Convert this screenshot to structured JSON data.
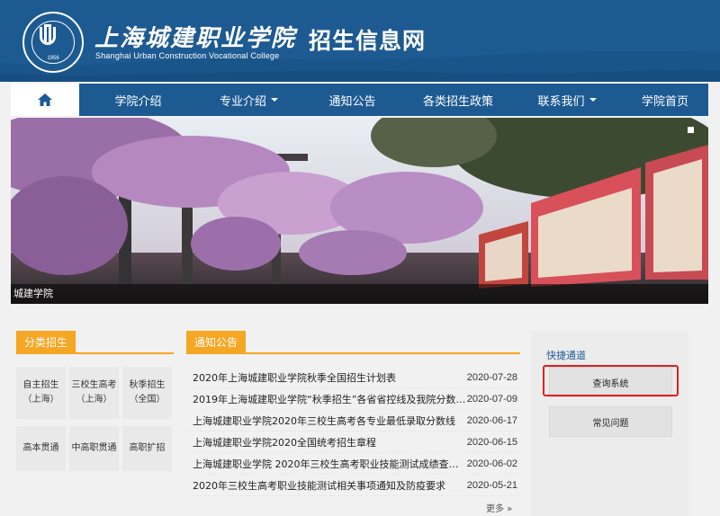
{
  "header": {
    "college_name_cn": "上海城建职业学院",
    "college_name_en": "Shanghai Urban Construction Vocational College",
    "site_title": "招生信息网",
    "logo_year": "1956",
    "logo_ring_text": "SHANGHAI URBAN CONSTRUCTION VOCATIONAL COLLEGE"
  },
  "nav": {
    "home_icon": "home-icon",
    "items": [
      {
        "label": "学院介绍",
        "dropdown": false
      },
      {
        "label": "专业介绍",
        "dropdown": true
      },
      {
        "label": "通知公告",
        "dropdown": false
      },
      {
        "label": "各类招生政策",
        "dropdown": false
      },
      {
        "label": "联系我们",
        "dropdown": true
      },
      {
        "label": "学院首页",
        "dropdown": false
      }
    ]
  },
  "banner": {
    "caption": "城建学院"
  },
  "categories": {
    "title": "分类招生",
    "items": [
      {
        "label": "自主招生\n（上海）"
      },
      {
        "label": "三校生高考\n（上海）"
      },
      {
        "label": "秋季招生\n（全国）"
      },
      {
        "label": "高本贯通"
      },
      {
        "label": "中高职贯通"
      },
      {
        "label": "高职扩招"
      }
    ]
  },
  "notices": {
    "title": "通知公告",
    "items": [
      {
        "title": "2020年上海城建职业学院秋季全国招生计划表",
        "date": "2020-07-28"
      },
      {
        "title": "2019年上海城建职业学院“秋季招生”各省省控线及我院分数线...",
        "date": "2020-07-09"
      },
      {
        "title": "上海城建职业学院2020年三校生高考各专业最低录取分数线",
        "date": "2020-06-17"
      },
      {
        "title": "上海城建职业学院2020全国统考招生章程",
        "date": "2020-06-15"
      },
      {
        "title": "上海城建职业学院 2020年三校生高考职业技能测试成绩查询及...",
        "date": "2020-06-02"
      },
      {
        "title": "2020年三校生高考职业技能测试相关事项通知及防疫要求",
        "date": "2020-05-21"
      }
    ],
    "more": "更多 »"
  },
  "quick": {
    "title": "快捷通道",
    "buttons": [
      {
        "label": "查询系统"
      },
      {
        "label": "常见问题"
      }
    ]
  },
  "colors": {
    "brand_blue": "#1d5a92",
    "accent_orange": "#f5a623",
    "highlight_red": "#e02020"
  }
}
